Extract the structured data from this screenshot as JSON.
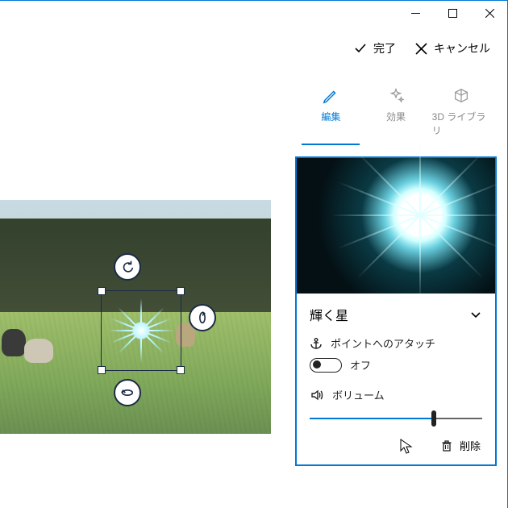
{
  "actions": {
    "done": "完了",
    "cancel": "キャンセル"
  },
  "tabs": {
    "edit": "編集",
    "effects": "効果",
    "library3d": "3D ライブラリ"
  },
  "effect": {
    "name": "輝く星",
    "attach_label": "ポイントへのアタッチ",
    "attach_state": "オフ",
    "volume_label": "ボリューム",
    "volume_value": 72,
    "delete": "削除"
  }
}
